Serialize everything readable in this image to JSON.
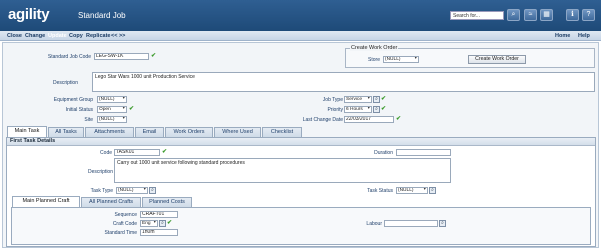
{
  "header": {
    "logo_text": "agility",
    "title": "Standard Job",
    "search_placeholder": "Search for...",
    "icons": [
      "search-icon",
      "rss-icon",
      "grid-icon",
      "info-icon",
      "help-icon"
    ]
  },
  "toolbar": {
    "left": [
      "Close",
      "Change",
      "Update",
      "Copy",
      "Replicate",
      "<< >>"
    ],
    "home": "Home",
    "help": "Help"
  },
  "form": {
    "standard_job_code_label": "Standard Job Code",
    "standard_job_code": "LEG-SW-1K",
    "description_label": "Description",
    "description": "Lego Star Wars 1000 unit Production Service",
    "equipment_group_label": "Equipment Group",
    "equipment_group": "(NULL)",
    "initial_status_label": "Initial Status",
    "initial_status": "Open",
    "site_label": "Site",
    "site": "(NULL)",
    "job_type_label": "Job Type",
    "job_type": "Service",
    "priority_label": "Priority",
    "priority": "6 Hours",
    "last_change_label": "Last Change Date",
    "last_change": "22/03/2017"
  },
  "create_order": {
    "group_title": "Create Work Order",
    "store_label": "Store",
    "store_value": "(NULL)",
    "button": "Create Work Order"
  },
  "tabs": [
    "Main Task",
    "All Tasks",
    "Attachments",
    "Email",
    "Work Orders",
    "Where Used",
    "Checklist"
  ],
  "task": {
    "section_title": "First Task Details",
    "code_label": "Code",
    "code": "TASK01",
    "duration_label": "Duration",
    "duration": "",
    "description_label": "Description",
    "description": "Carry out 1000 unit service following standard procedures",
    "task_type_label": "Task Type",
    "task_type": "(NULL)",
    "task_status_label": "Task Status",
    "task_status": "(NULL)"
  },
  "sub_tabs": [
    "Main Planned Craft",
    "All Planned Crafts",
    "Planned Costs"
  ],
  "craft": {
    "sequence_label": "Sequence",
    "sequence": "CRAFT01",
    "craft_code_label": "Craft Code",
    "craft_code": "Eng",
    "labour_label": "Labour",
    "labour": "",
    "standard_time_label": "Standard Time",
    "standard_time": "1h0m"
  }
}
